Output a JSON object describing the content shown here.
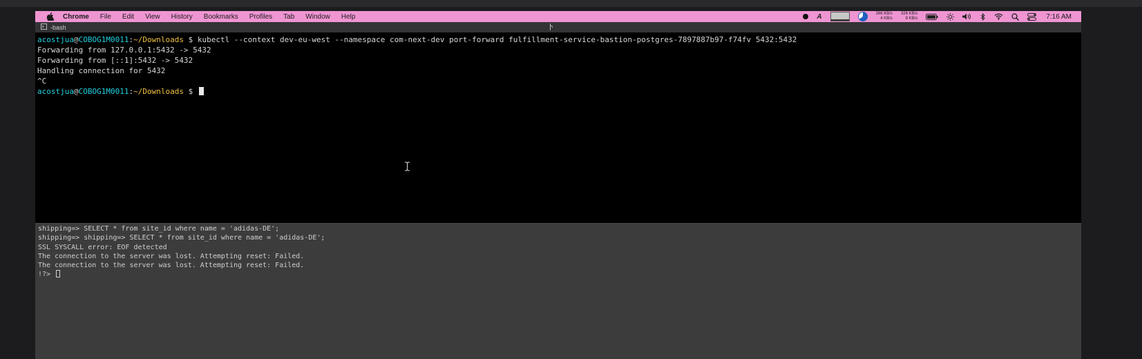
{
  "menubar": {
    "app": "Chrome",
    "items": [
      "File",
      "Edit",
      "View",
      "History",
      "Bookmarks",
      "Profiles",
      "Tab",
      "Window",
      "Help"
    ],
    "net_up": "266 KB/s",
    "net_down": "4 KB/s",
    "net_up2": "326 KB/s",
    "net_down2": "9 KB/s",
    "clock": "7:16 AM",
    "icons": [
      "apple-icon",
      "record-dot-icon",
      "input-source-icon",
      "cpu-graph-icon",
      "disk-pie-icon",
      "network-stats-icon",
      "battery-icon",
      "brightness-icon",
      "volume-icon",
      "bluetooth-icon",
      "wifi-icon",
      "spotlight-icon",
      "control-center-icon"
    ]
  },
  "tabs": {
    "active_label": "-bash",
    "second_label": ""
  },
  "terminal_top": {
    "prompt_user": "acostjua",
    "prompt_at": "@",
    "prompt_host": "COBOG1M0011",
    "prompt_colon": ":",
    "prompt_path": "~/Downloads",
    "prompt_symbol": " $ ",
    "command": "kubectl --context dev-eu-west --namespace com-next-dev port-forward fulfillment-service-bastion-postgres-7897887b97-f74fv 5432:5432",
    "output": [
      "Forwarding from 127.0.0.1:5432 -> 5432",
      "Forwarding from [::1]:5432 -> 5432",
      "Handling connection for 5432",
      "^C"
    ]
  },
  "terminal_bottom": {
    "lines": [
      "shipping=> SELECT * from site_id where name = 'adidas-DE';",
      "shipping=> shipping=> SELECT * from site_id where name = 'adidas-DE';",
      "SSL SYSCALL error: EOF detected",
      "The connection to the server was lost. Attempting reset: Failed.",
      "The connection to the server was lost. Attempting reset: Failed."
    ],
    "prompt": "!?> "
  },
  "colors": {
    "menubar_bg": "#ef95d2",
    "terminal_bg": "#000000",
    "pane2_bg": "#3c3c3c",
    "user_color": "#1fd1e0",
    "path_color": "#f2c240"
  }
}
